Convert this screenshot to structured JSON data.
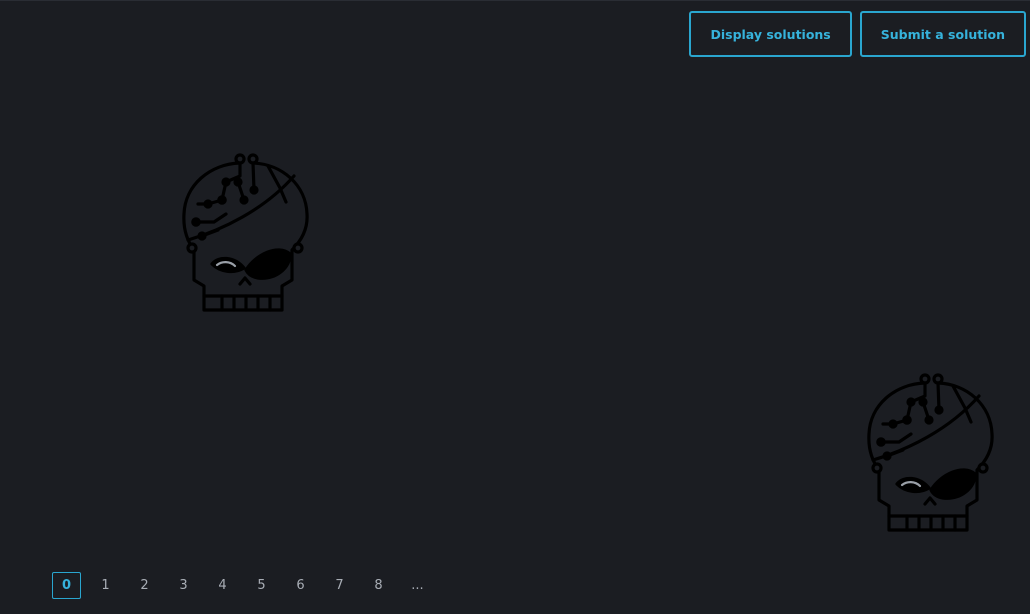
{
  "toolbar": {
    "display_solutions_label": "Display solutions",
    "submit_solution_label": "Submit a solution"
  },
  "decor": {
    "icon": "cyber-skull-icon",
    "colors": {
      "background": "#1b1d22",
      "accent": "#2aa6cf",
      "skull": "#000000"
    }
  },
  "pagination": {
    "current": "0",
    "pages": [
      "0",
      "1",
      "2",
      "3",
      "4",
      "5",
      "6",
      "7",
      "8"
    ],
    "ellipsis": "..."
  }
}
